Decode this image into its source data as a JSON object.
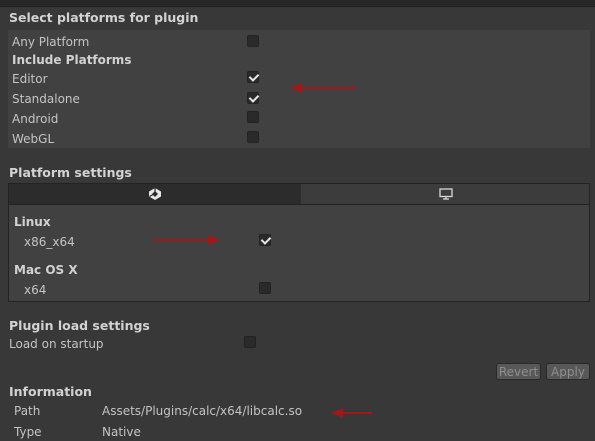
{
  "platforms": {
    "title": "Select platforms for plugin",
    "any_platform": {
      "label": "Any Platform",
      "checked": false
    },
    "include_title": "Include Platforms",
    "items": [
      {
        "label": "Editor",
        "checked": true
      },
      {
        "label": "Standalone",
        "checked": true
      },
      {
        "label": "Android",
        "checked": false
      },
      {
        "label": "WebGL",
        "checked": false
      }
    ]
  },
  "platform_settings": {
    "title": "Platform settings",
    "tabs": [
      {
        "icon": "unity-icon",
        "selected": true
      },
      {
        "icon": "monitor-icon",
        "selected": false
      }
    ],
    "groups": [
      {
        "title": "Linux",
        "option": {
          "label": "x86_x64",
          "checked": true
        }
      },
      {
        "title": "Mac OS X",
        "option": {
          "label": "x64",
          "checked": false
        }
      }
    ]
  },
  "load_settings": {
    "title": "Plugin load settings",
    "load_on_startup": {
      "label": "Load on startup",
      "checked": false
    }
  },
  "buttons": {
    "revert": "Revert",
    "apply": "Apply"
  },
  "information": {
    "title": "Information",
    "rows": [
      {
        "key": "Path",
        "value": "Assets/Plugins/calc/x64/libcalc.so"
      },
      {
        "key": "Type",
        "value": "Native"
      }
    ]
  },
  "colors": {
    "annotation_arrow": "#a01818",
    "background": "#383838",
    "panel": "#414141"
  }
}
